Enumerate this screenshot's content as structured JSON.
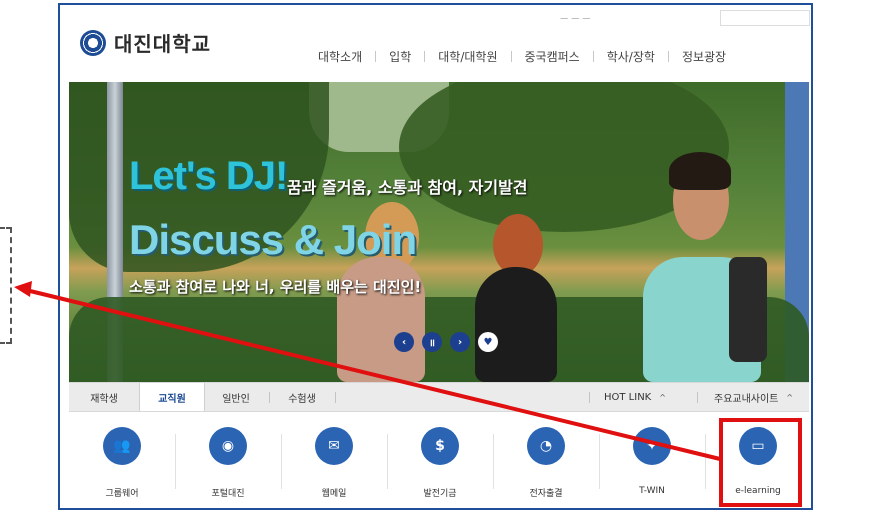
{
  "brand": {
    "name": "대진대학교"
  },
  "top_nav": [
    "대학소개",
    "입학",
    "대학/대학원",
    "중국캠퍼스",
    "학사/장학",
    "정보광장"
  ],
  "util_text": "ㅡ ㅡ ㅡ",
  "hero": {
    "title1": "Let's DJ!",
    "subtitle1": "꿈과 즐거움, 소통과 참여, 자기발견",
    "title2": "Discuss & Join",
    "subtitle2": "소통과 참여로 나와 너, 우리를 배우는 대진인!",
    "controls": {
      "prev": "‹",
      "pause": "॥",
      "next": "›",
      "extra": "♥"
    }
  },
  "tabs": [
    "재학생",
    "교직원",
    "일반인",
    "수험생"
  ],
  "active_tab": "교직원",
  "hot_link": {
    "label": "HOT LINK",
    "caret": "^"
  },
  "main_sites": {
    "label": "주요교내사이트",
    "caret": "^"
  },
  "quick_links": [
    {
      "label": "그룹웨어",
      "icon": "👥"
    },
    {
      "label": "포털대진",
      "icon": "◉"
    },
    {
      "label": "웹메일",
      "icon": "✉"
    },
    {
      "label": "발전기금",
      "icon": "$"
    },
    {
      "label": "전자출결",
      "icon": "◔"
    },
    {
      "label": "T-WIN",
      "icon": "✦"
    },
    {
      "label": "e-learning",
      "icon": "▭"
    }
  ],
  "colors": {
    "accent": "#1d4b94",
    "highlight": "#e01010",
    "icon_bg": "#2a64b3"
  }
}
